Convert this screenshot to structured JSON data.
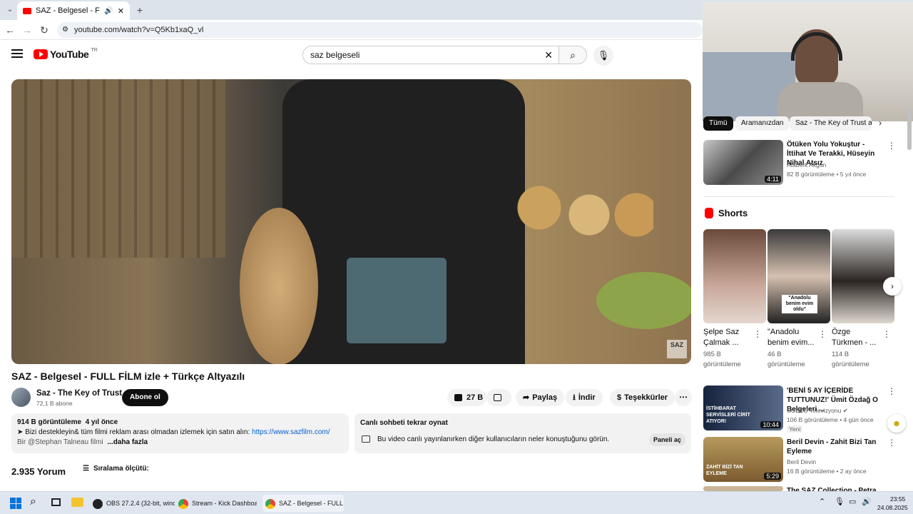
{
  "browser": {
    "tab_title": "SAZ - Belgesel - FULL FİLM",
    "url": "youtube.com/watch?v=Q5Kb1xaQ_vl"
  },
  "header": {
    "logo_text": "YouTube",
    "region": "TR",
    "search_value": "saz belgeseli"
  },
  "video": {
    "title": "SAZ - Belgesel - FULL FİLM izle + Türkçe Altyazılı",
    "watermark": "SAZ",
    "channel_name": "Saz - The Key of Trust",
    "subscribers": "72,1 B abone",
    "subscribe_label": "Abone ol",
    "likes": "27 B",
    "share_label": "Paylaş",
    "download_label": "İndir",
    "thanks_label": "Teşekkürler"
  },
  "description": {
    "stats": "914 B görüntüleme  4 yıl önce",
    "line1_prefix": "➤ Bizi destekleyin& tüm filmi reklam arası olmadan izlemek için satın alın: ",
    "line1_link": "https://www.sazfilm.com/",
    "line2": "Bir @Stephan Talneau filmi",
    "more_label": "...daha fazla"
  },
  "livechat": {
    "title": "Canlı sohbeti tekrar oynat",
    "text": "Bu video canlı yayınlanırken diğer kullanıcıların neler konuştuğunu görün.",
    "button": "Paneli aç"
  },
  "comments": {
    "count": "2.935 Yorum",
    "sort_label": "Sıralama ölçütü:"
  },
  "sidebar": {
    "chips": [
      "Tümü",
      "Aramanızdan",
      "Saz - The Key of Trust ad"
    ],
    "recs": [
      {
        "title": "Ötüken Yolu Yokuştur - İttihat Ve Terakki, Hüseyin Nihal Atsız",
        "channel": "Ataberk Akgün",
        "meta": "82 B görüntüleme • 5 yıl önce",
        "duration": "4:11"
      },
      {
        "title": "'BENİ 5 AY İÇERİDE TUTTUNUZ!' Ümit Özdağ O Belgeleri ...",
        "channel": "SÖZCÜ Televizyonu",
        "meta": "106 B görüntüleme • 4 gün önce",
        "badge": "Yeni",
        "duration": "10:44",
        "thumb_text": "İSTİHBARAT SERVİSLERİ CİRİT ATIYOR!"
      },
      {
        "title": "Beril Devin - Zahit Bizi Tan Eyleme",
        "channel": "Beril Devin",
        "meta": "16 B görüntüleme • 2 ay önce",
        "duration": "5:29",
        "thumb_text": "ZAHİT BİZİ TAN EYLEME"
      },
      {
        "title": "The SAZ Collection - Petra"
      }
    ],
    "shorts_heading": "Shorts",
    "shorts": [
      {
        "title1": "Şelpe Saz",
        "title2": "Çalmak ...",
        "views": "985 B",
        "views_label": "görüntüleme"
      },
      {
        "title1": "\"Anadolu",
        "title2": "benim evim...",
        "views": "46 B",
        "views_label": "görüntüleme",
        "caption": "\"Anadolu benim evim oldu\""
      },
      {
        "title1": "Özge",
        "title2": "Türkmen - ...",
        "views": "114 B",
        "views_label": "görüntüleme"
      }
    ]
  },
  "taskbar": {
    "items": [
      "OBS 27.2.4 (32-bit, wind",
      "Stream - Kick Dashboar",
      "SAZ - Belgesel - FULL Fİ"
    ],
    "time": "23:55",
    "date": "24.08.2025"
  },
  "colors": {
    "yt_red": "#ff0000",
    "link_blue": "#065fd4",
    "taskbar": "#dfe6f0"
  }
}
